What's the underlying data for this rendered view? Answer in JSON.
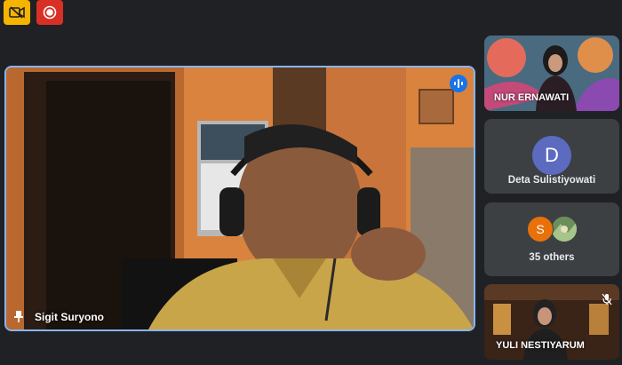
{
  "toolbar": {
    "camera_off_icon": "video-off-icon",
    "record_icon": "record-icon"
  },
  "main": {
    "name": "Sigit Suryono",
    "pin_icon": "pin-icon",
    "speaking_icon": "audio-wave-icon",
    "highlight_color": "#8ab4f8"
  },
  "participants": [
    {
      "name": "NUR ERNAWATI"
    },
    {
      "name": "Deta Sulistiyowati",
      "initial": "D",
      "avatar_color": "#5c6bc0"
    },
    {
      "name": "35 others",
      "initial": "S",
      "avatar_color": "#e8710a"
    },
    {
      "name": "YULI NESTIYARUM",
      "muted_icon": "mic-off-icon"
    }
  ]
}
